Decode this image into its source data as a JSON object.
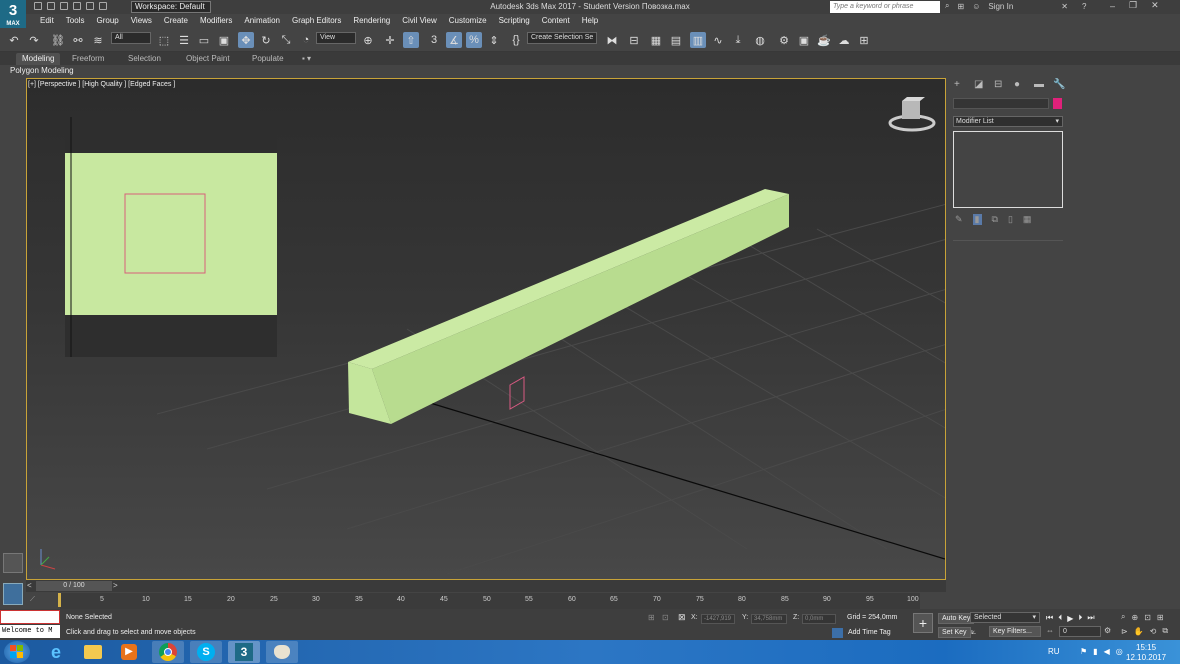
{
  "app": {
    "logo": "3",
    "logo_sub": "MAX",
    "title": "Autodesk 3ds Max 2017 - Student Version   Повозка.max",
    "workspace": "Workspace: Default",
    "search_placeholder": "Type a keyword or phrase",
    "sign_in": "Sign In"
  },
  "menu": [
    "Edit",
    "Tools",
    "Group",
    "Views",
    "Create",
    "Modifiers",
    "Animation",
    "Graph Editors",
    "Rendering",
    "Civil View",
    "Customize",
    "Scripting",
    "Content",
    "Help"
  ],
  "toolbar": {
    "filter": "All",
    "ref_coord": "View",
    "selection_set": "Create Selection Se"
  },
  "ribbon": {
    "tabs": [
      "Modeling",
      "Freeform",
      "Selection",
      "Object Paint",
      "Populate"
    ],
    "active": "Modeling",
    "sub": "Polygon Modeling"
  },
  "viewport": {
    "label": "[+] [Perspective ] [High Quality ] [Edged Faces ]",
    "object_color": "#c2e49c"
  },
  "command_panel": {
    "modifier_list": "Modifier List",
    "color": "#e0217a"
  },
  "timeline": {
    "frame": "0 / 100",
    "ticks": [
      "5",
      "10",
      "15",
      "20",
      "25",
      "30",
      "35",
      "40",
      "45",
      "50",
      "55",
      "60",
      "65",
      "70",
      "75",
      "80",
      "85",
      "90",
      "95",
      "100"
    ]
  },
  "status": {
    "selected": "None Selected",
    "prompt": "Click and drag to select and move objects",
    "welcome": "Welcome to M",
    "x_label": "X:",
    "x_val": "-1427,919",
    "y_label": "Y:",
    "y_val": "34,758mm",
    "z_label": "Z:",
    "z_val": "0,0mm",
    "grid": "Grid = 254,0mm",
    "add_time_tag": "Add Time Tag",
    "auto_key": "Auto Key",
    "set_key": "Set Key",
    "selected_dd": "Selected",
    "key_filters": "Key Filters...",
    "frame_field": "0"
  },
  "taskbar": {
    "lang": "RU",
    "time": "15:15",
    "date": "12.10.2017"
  }
}
